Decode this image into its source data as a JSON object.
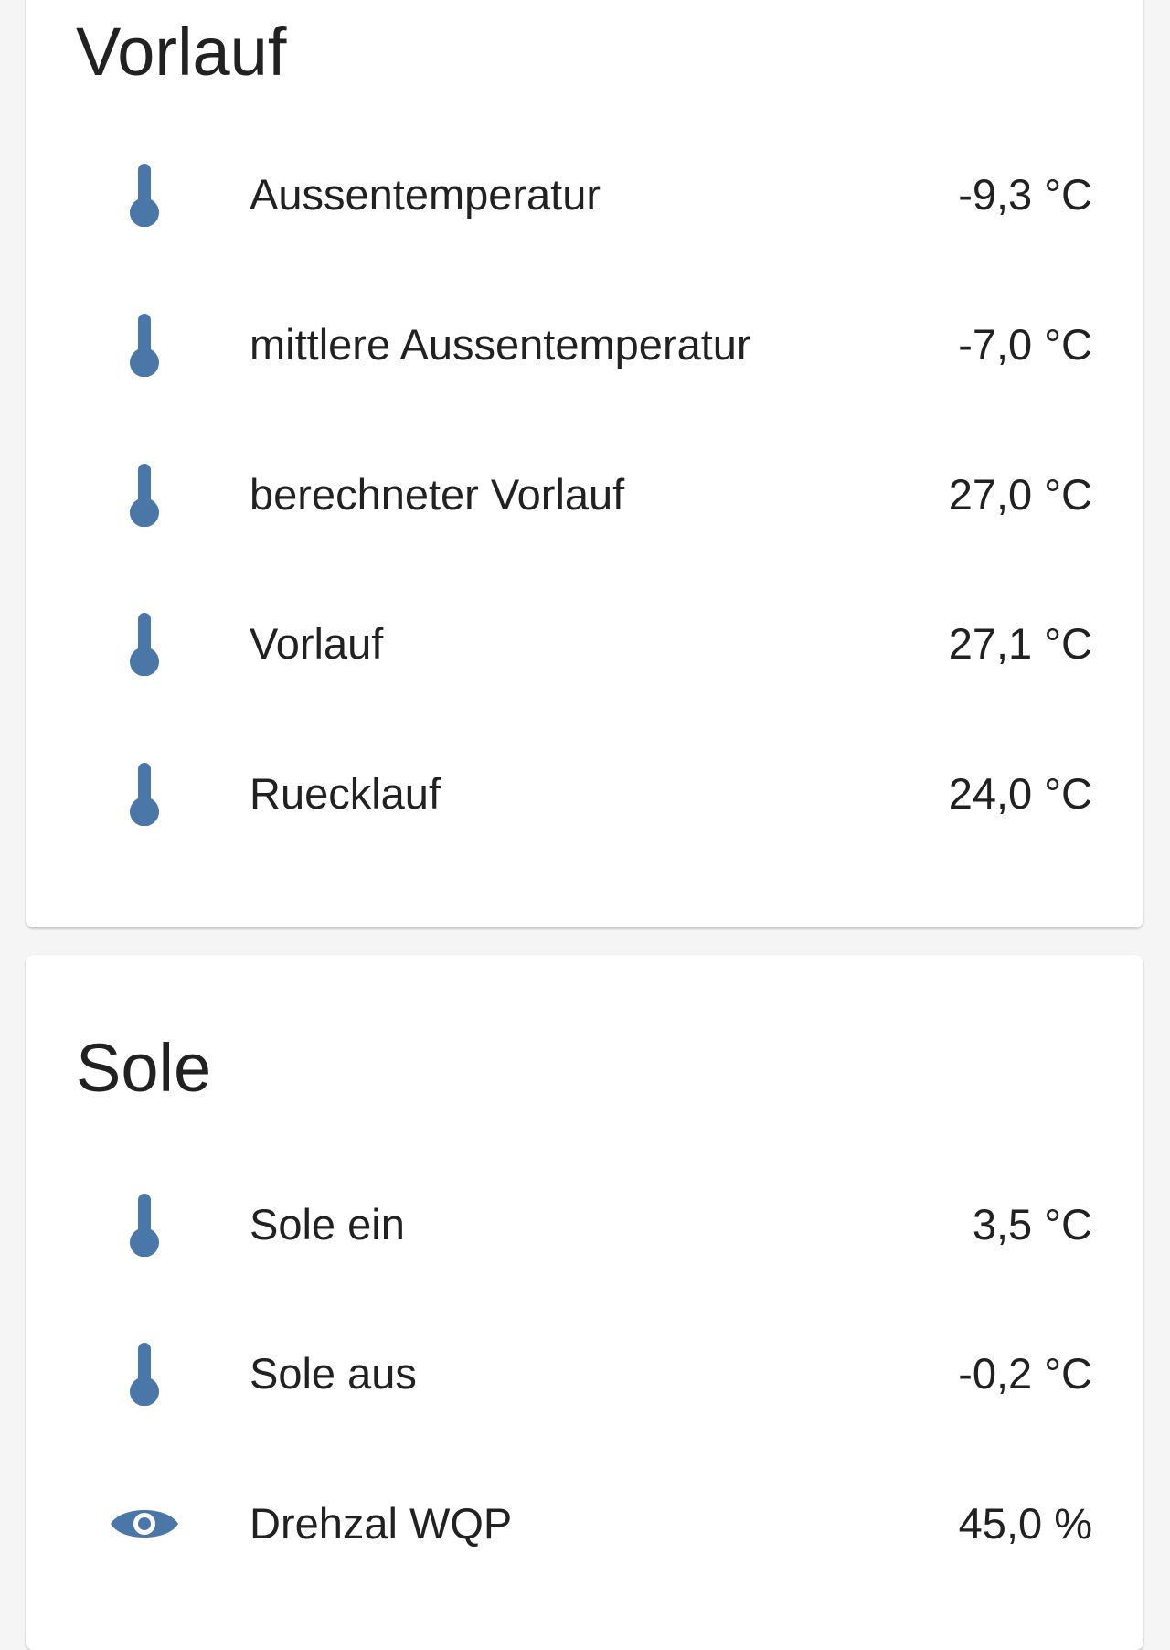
{
  "colors": {
    "icon": "#4a77a8",
    "background": "#f5f5f5",
    "card": "#ffffff",
    "text": "#212121"
  },
  "cards": [
    {
      "title": "Vorlauf",
      "rows": [
        {
          "icon": "thermometer-icon",
          "label": "Aussentemperatur",
          "value": "-9,3 °C"
        },
        {
          "icon": "thermometer-icon",
          "label": "mittlere Aussentemperatur",
          "value": "-7,0 °C"
        },
        {
          "icon": "thermometer-icon",
          "label": "berechneter Vorlauf",
          "value": "27,0 °C"
        },
        {
          "icon": "thermometer-icon",
          "label": "Vorlauf",
          "value": "27,1 °C"
        },
        {
          "icon": "thermometer-icon",
          "label": "Ruecklauf",
          "value": "24,0 °C"
        }
      ]
    },
    {
      "title": "Sole",
      "rows": [
        {
          "icon": "thermometer-icon",
          "label": "Sole ein",
          "value": "3,5 °C"
        },
        {
          "icon": "thermometer-icon",
          "label": "Sole aus",
          "value": "-0,2 °C"
        },
        {
          "icon": "eye-icon",
          "label": "Drehzal WQP",
          "value": "45,0 %"
        }
      ]
    }
  ]
}
